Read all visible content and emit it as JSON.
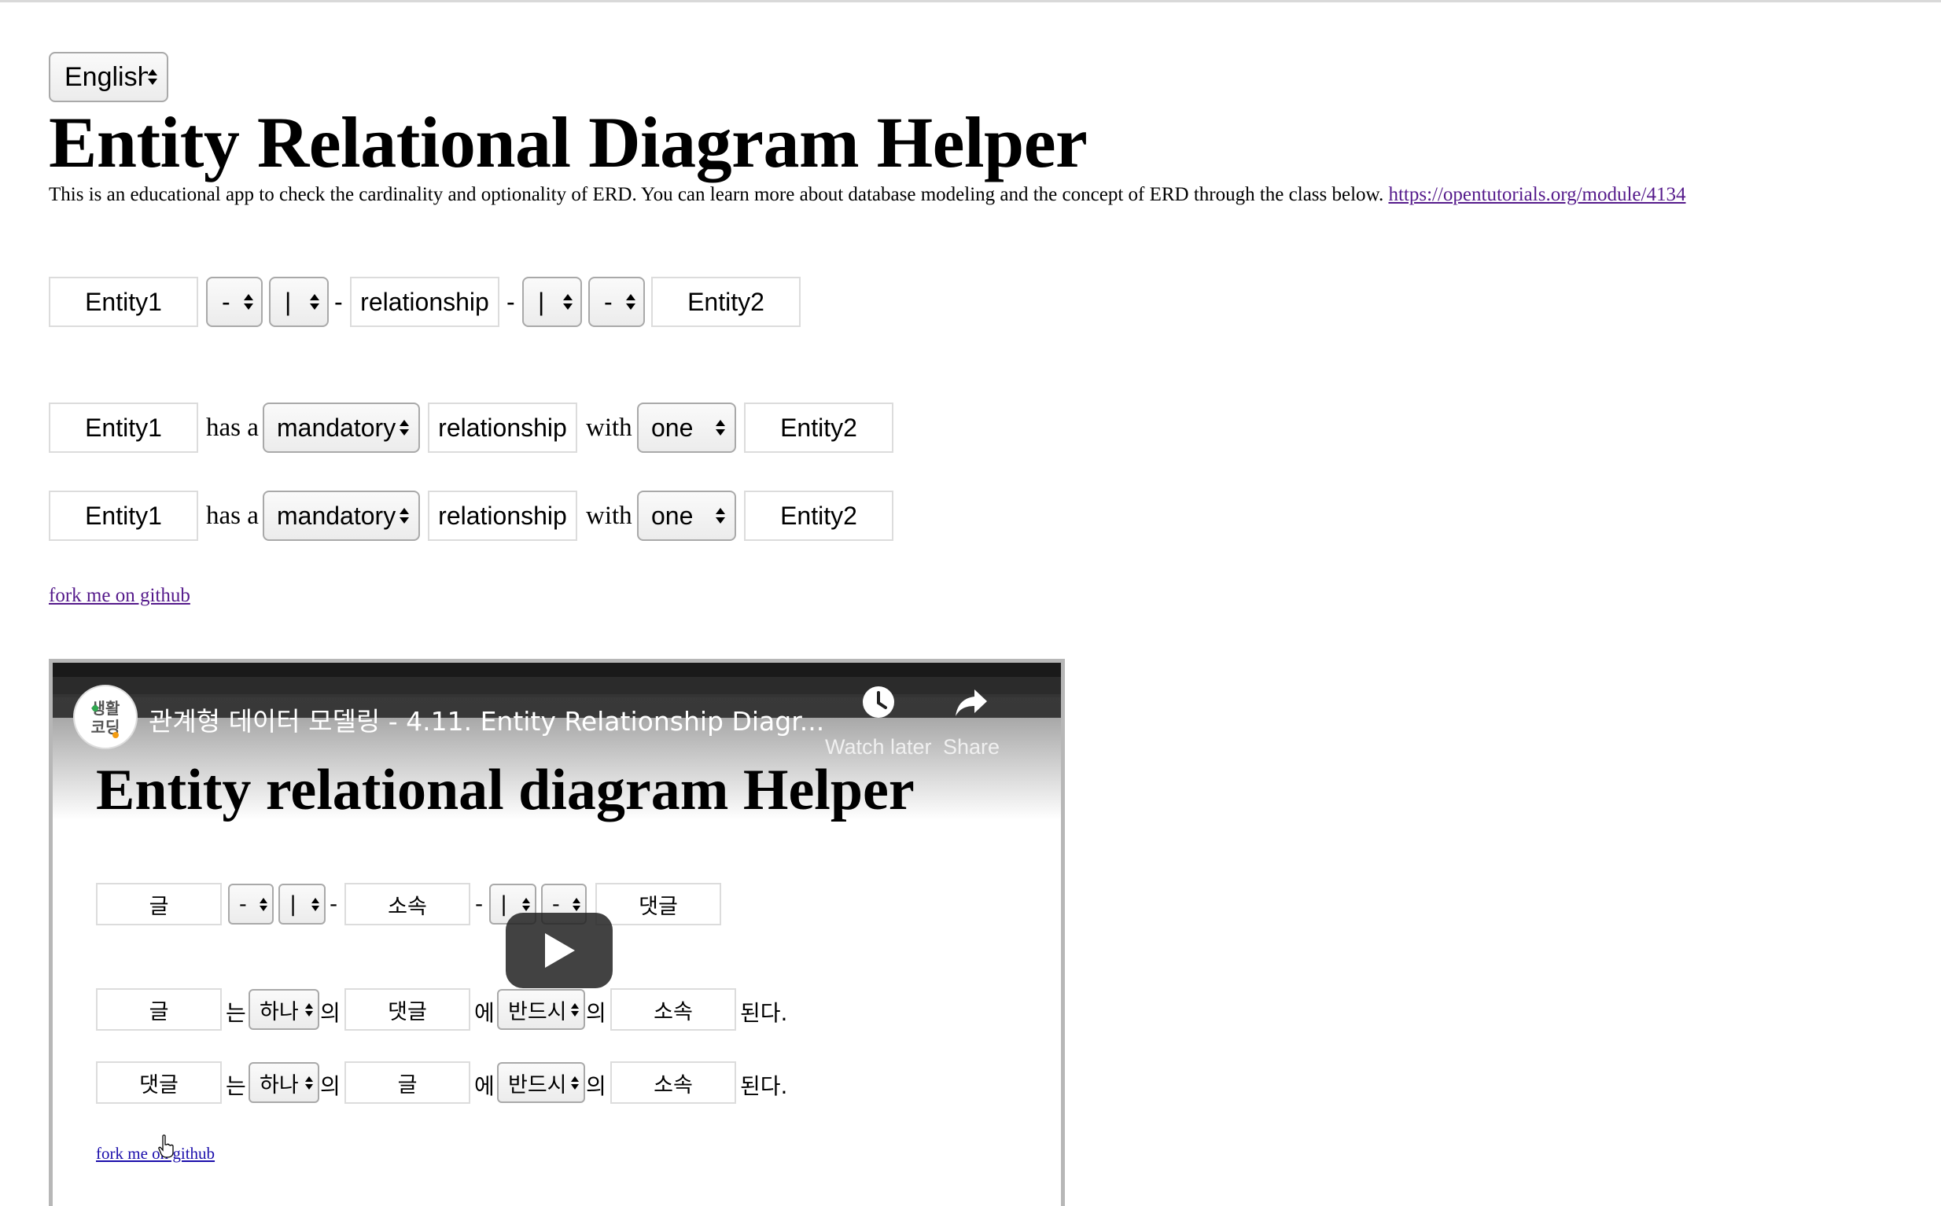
{
  "language": {
    "selected": "English"
  },
  "title": "Entity Relational Diagram Helper",
  "intro": {
    "text": "This is an educational app to check the cardinality and optionality of ERD. You can learn more about database modeling and the concept of ERD through the class below. ",
    "link": "https://opentutorials.org/module/4134"
  },
  "diagram": {
    "entity1": "Entity1",
    "left_optionality": "-",
    "left_cardinality": "|",
    "dash": "-",
    "relationship": "relationship",
    "right_cardinality": "|",
    "right_optionality": "-",
    "entity2": "Entity2"
  },
  "sentences": [
    {
      "entity_a": "Entity1",
      "has_a": "has a",
      "optionality": "mandatory",
      "relationship": "relationship",
      "with": "with",
      "cardinality": "one",
      "entity_b": "Entity2"
    },
    {
      "entity_a": "Entity1",
      "has_a": "has a",
      "optionality": "mandatory",
      "relationship": "relationship",
      "with": "with",
      "cardinality": "one",
      "entity_b": "Entity2"
    }
  ],
  "fork_link": "fork me on github",
  "video": {
    "title": "관계형 데이터 모델링 - 4.11. Entity Relationship Diagr...",
    "channel_logo_text": "생활\n코딩",
    "watch_later": "Watch later",
    "share": "Share",
    "heading": "Entity relational diagram Helper",
    "diagram": {
      "entity1": "글",
      "left_optionality": "-",
      "left_cardinality": "|",
      "dash": "-",
      "relationship": "소속",
      "right_cardinality": "|",
      "right_optionality": "-",
      "entity2": "댓글"
    },
    "sentences": [
      {
        "entity_a": "글",
        "particle_a": "는",
        "cardinality": "하나",
        "particle_b": "의",
        "entity_b": "댓글",
        "particle_c": "에",
        "optionality": "반드시",
        "particle_d": "의",
        "relationship": "소속",
        "ending": "된다."
      },
      {
        "entity_a": "댓글",
        "particle_a": "는",
        "cardinality": "하나",
        "particle_b": "의",
        "entity_b": "글",
        "particle_c": "에",
        "optionality": "반드시",
        "particle_d": "의",
        "relationship": "소속",
        "ending": "된다."
      }
    ],
    "fork_link": "fork me on github"
  }
}
